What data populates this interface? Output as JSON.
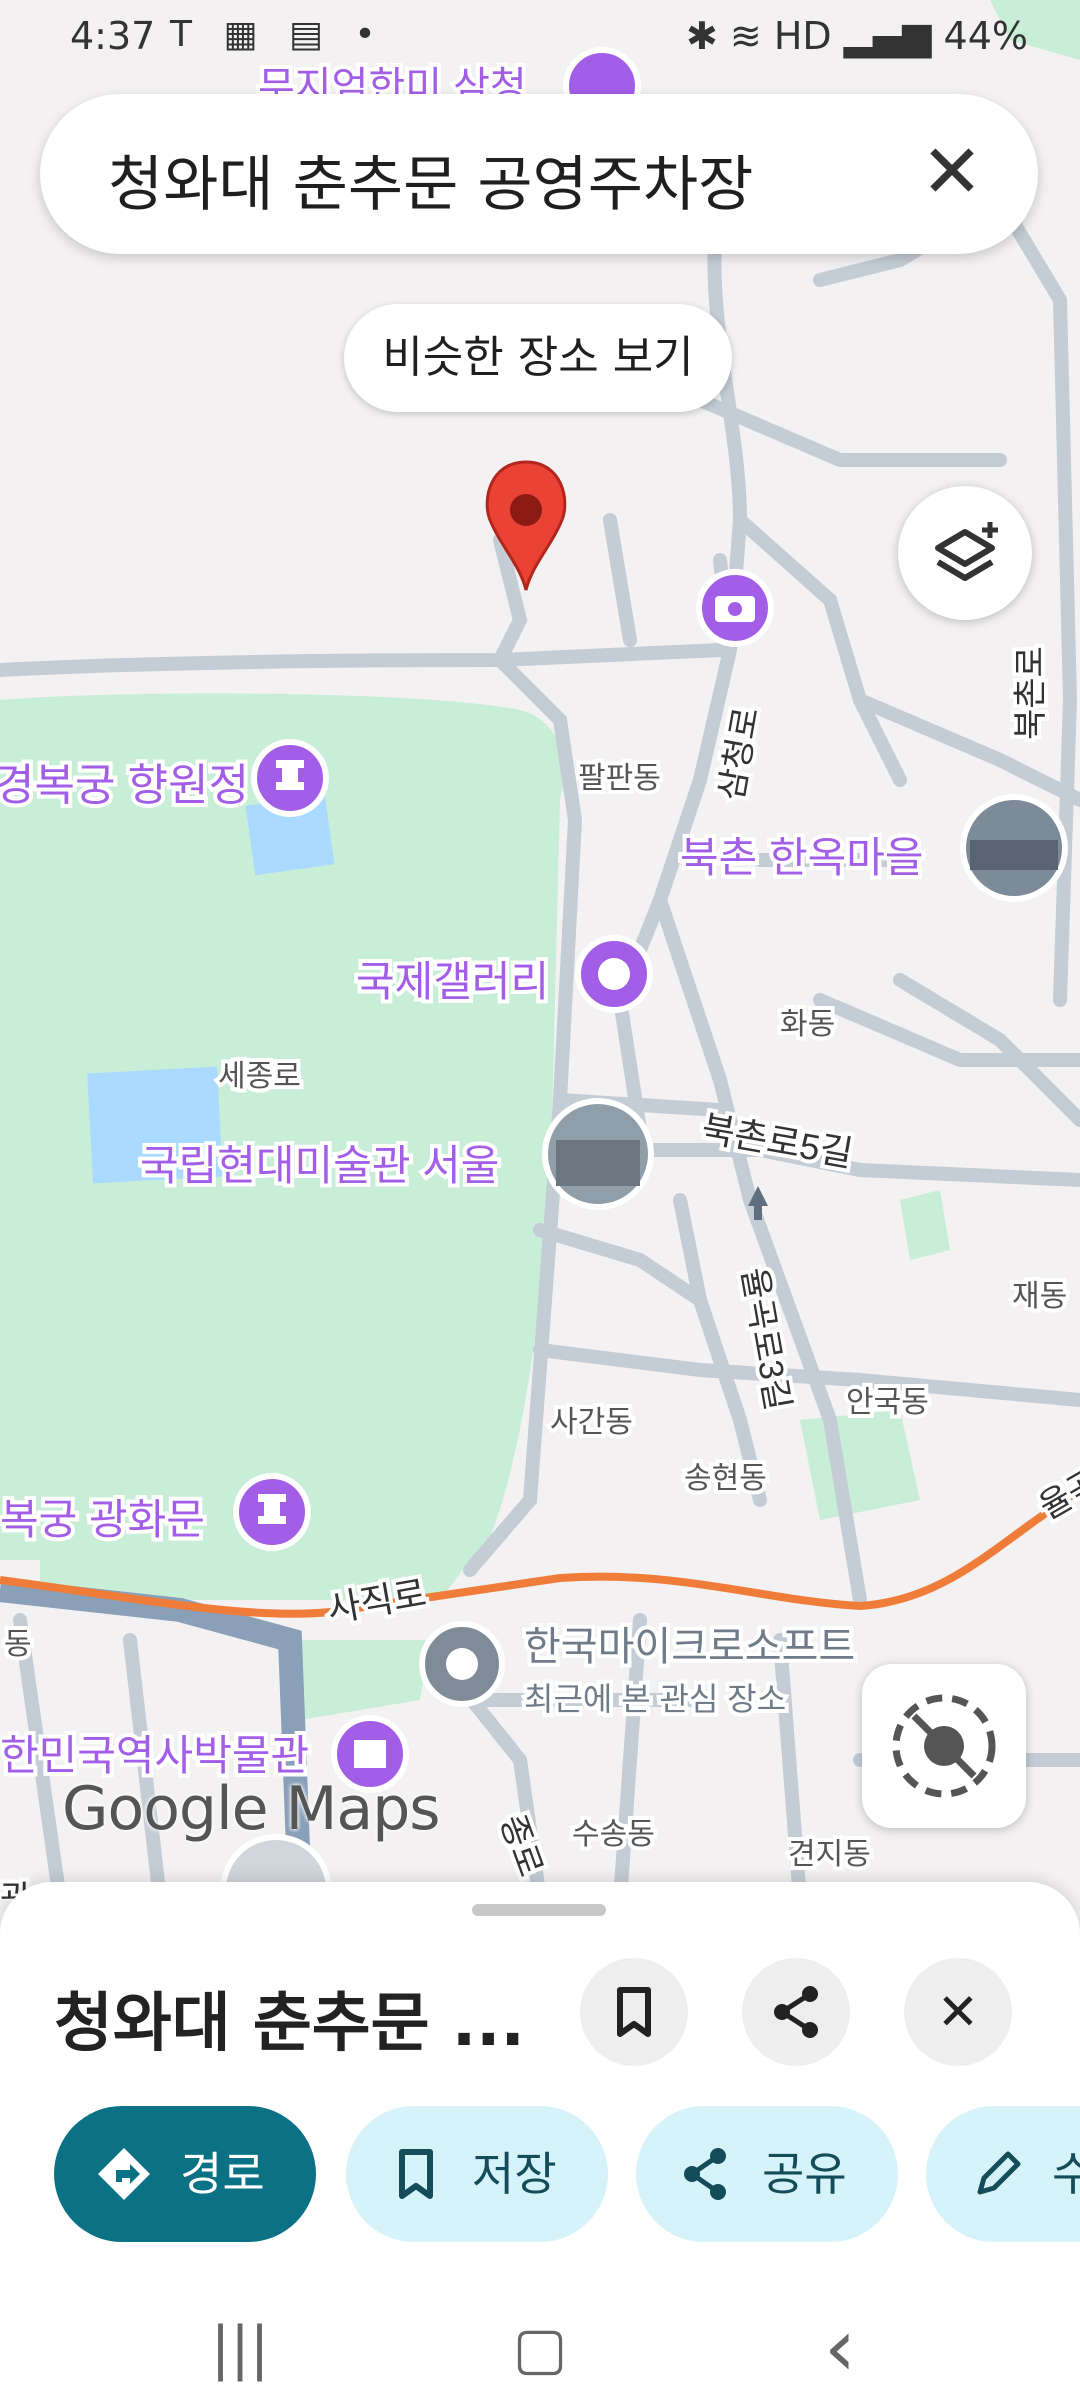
{
  "status_bar": {
    "time": "4:37",
    "left_icons": "T ▦ ▤ •",
    "right_icons": "✱ ≋ HD ▂▄▆",
    "battery": "44%"
  },
  "search": {
    "query": "청와대 춘추문 공영주차장",
    "clear_icon": "✕"
  },
  "similar_places_label": "비슷한 장소 보기",
  "map": {
    "places": [
      {
        "name": "경복궁 향원정",
        "category": "landmark"
      },
      {
        "name": "북촌 한옥마을",
        "category": "photo"
      },
      {
        "name": "국제갤러리",
        "category": "gallery"
      },
      {
        "name": "국립현대미술관 서울",
        "category": "photo"
      },
      {
        "name": "복궁 광화문",
        "category": "landmark"
      },
      {
        "name": "한국마이크로소프트",
        "category": "saved"
      },
      {
        "name": "한민국역사박물관",
        "category": "museum"
      },
      {
        "name": "무지엄한미 삼청",
        "category": "museum"
      }
    ],
    "saved_caption": "최근에 본 관심 장소",
    "areas": [
      "팔판동",
      "화동",
      "세종로",
      "사간동",
      "안국동",
      "송현동",
      "재동",
      "수송동",
      "견지동",
      "동"
    ],
    "roads": [
      "삼청로",
      "북촌로",
      "북촌로5길",
      "율곡로3길",
      "사직로",
      "율곡로",
      "종로",
      "광"
    ],
    "logo": "Google Maps",
    "colors": {
      "park": "#c9eed7",
      "road": "#c4ccd6",
      "trunk_road": "#f07c3a",
      "poi": "#a35ee8",
      "pin": "#ea4335"
    }
  },
  "sheet": {
    "title": "청와대 춘추문 ...",
    "bookmark_icon": "bookmark-icon",
    "share_icon": "share-icon",
    "close_icon": "✕",
    "actions": [
      {
        "label": "경로",
        "icon": "directions-icon"
      },
      {
        "label": "저장",
        "icon": "bookmark-icon"
      },
      {
        "label": "공유",
        "icon": "share-icon"
      },
      {
        "label": "수",
        "icon": "edit-icon"
      }
    ]
  },
  "nav": {
    "recents": "|||",
    "home": "▢",
    "back": "‹"
  }
}
